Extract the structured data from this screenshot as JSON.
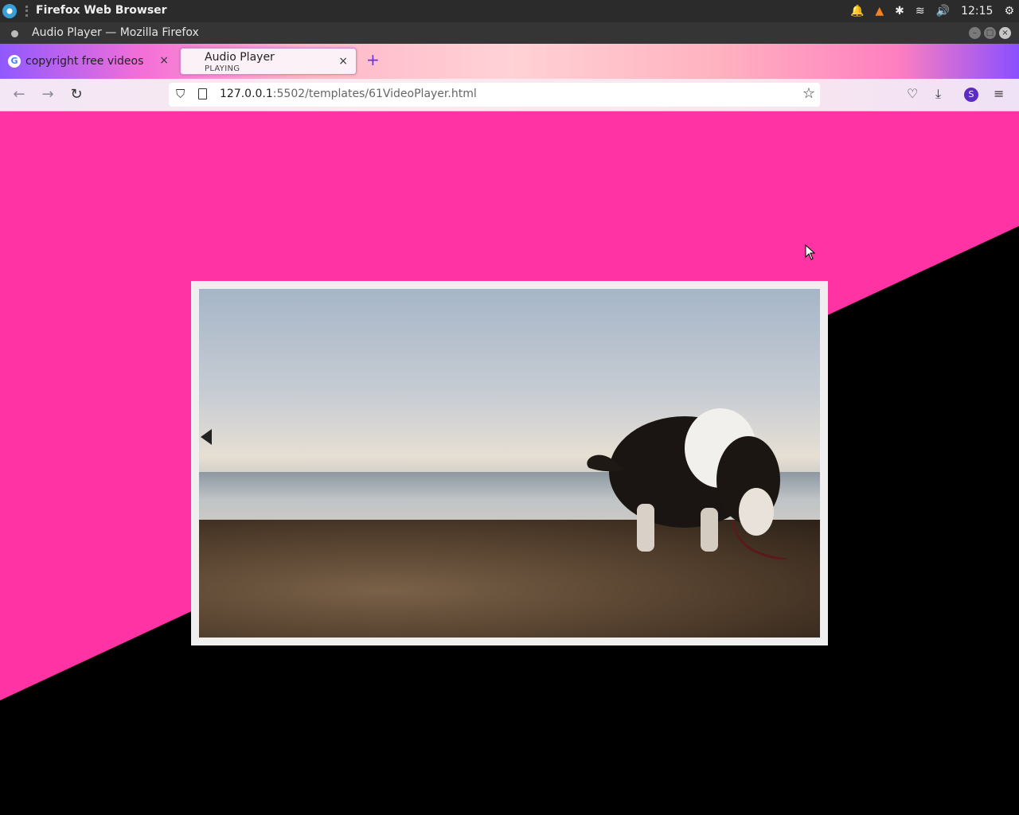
{
  "topbar": {
    "app_name": "Firefox Web Browser",
    "clock": "12:15",
    "tray_icons": [
      "bell-icon",
      "vlc-icon",
      "bluetooth-icon",
      "wifi-icon",
      "volume-icon",
      "settings-icon"
    ]
  },
  "window": {
    "title": "Audio Player — Mozilla Firefox"
  },
  "tabs": [
    {
      "label": "copyright free videos",
      "favicon": "G",
      "close": "×"
    },
    {
      "label": "Audio Player",
      "sublabel": "PLAYING",
      "close": "×",
      "active": true
    }
  ],
  "newtab_label": "+",
  "urlbar": {
    "host": "127.0.0.1",
    "path": ":5502/templates/61VideoPlayer.html"
  },
  "colors": {
    "page_pink": "#ff33a3",
    "page_black": "#000000",
    "player_frame": "#efefef"
  }
}
